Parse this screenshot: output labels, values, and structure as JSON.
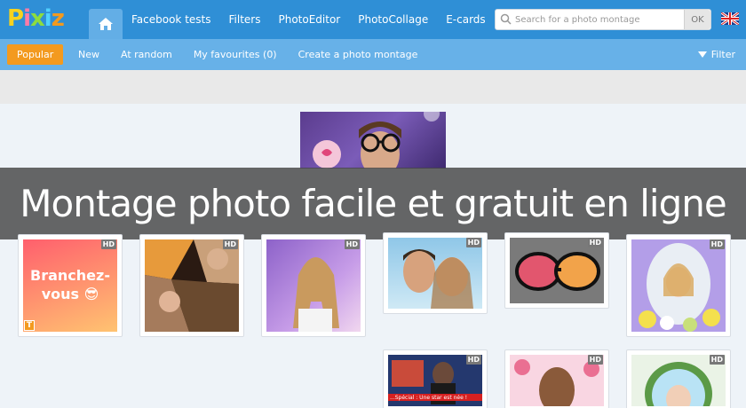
{
  "brand": {
    "logo_text": "Pixiz"
  },
  "nav": {
    "links": [
      "Facebook tests",
      "Filters",
      "PhotoEditor",
      "PhotoCollage",
      "E-cards"
    ]
  },
  "search": {
    "placeholder": "Search for a photo montage",
    "button": "OK"
  },
  "subnav": {
    "active": "Popular",
    "links": [
      "New",
      "At random",
      "My favourites (0)",
      "Create a photo montage"
    ],
    "filter": "Filter"
  },
  "banner": {
    "title": "Montage photo facile et gratuit en ligne"
  },
  "thumbs": [
    {
      "hd": "HD",
      "text": "Branchez-vous 😎",
      "badge": "T"
    },
    {
      "hd": "HD"
    },
    {
      "hd": "HD"
    },
    {
      "hd": "HD"
    },
    {
      "hd": "HD"
    },
    {
      "hd": "HD"
    },
    {
      "hd": "HD",
      "caption": "...Spécial : Une star est née !"
    },
    {
      "hd": "HD"
    },
    {
      "hd": "HD"
    }
  ],
  "colors": {
    "topbar": "#2f8fd6",
    "subbar": "#67b1e8",
    "accent": "#f39a1f"
  }
}
